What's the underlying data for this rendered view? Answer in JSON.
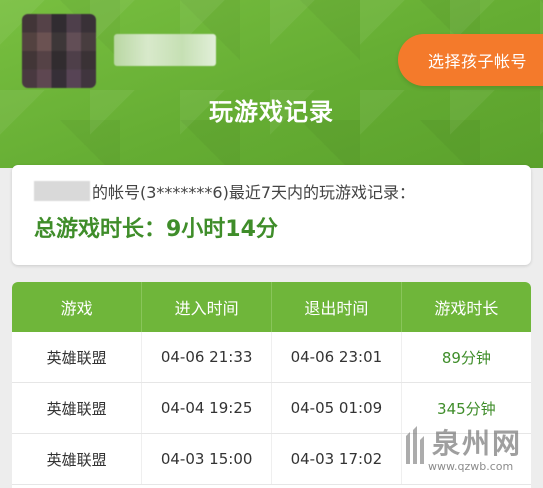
{
  "header": {
    "select_child_label": "选择孩子帐号",
    "title": "玩游戏记录"
  },
  "summary": {
    "account_text": "的帐号(3*******6)最近7天内的玩游戏记录：",
    "total_label": "总游戏时长：9小时14分"
  },
  "table": {
    "columns": [
      "游戏",
      "进入时间",
      "退出时间",
      "游戏时长"
    ],
    "rows": [
      [
        "英雄联盟",
        "04-06 21:33",
        "04-06 23:01",
        "89分钟"
      ],
      [
        "英雄联盟",
        "04-04 19:25",
        "04-05 01:09",
        "345分钟"
      ],
      [
        "英雄联盟",
        "04-03 15:00",
        "04-03 17:02",
        ""
      ]
    ]
  },
  "watermark": {
    "brand": "泉州网",
    "url": "www.qzwb.com"
  },
  "colors": {
    "brand_green": "#6fb63a",
    "accent_orange": "#f47a2b",
    "text_green": "#3f8d2a"
  }
}
